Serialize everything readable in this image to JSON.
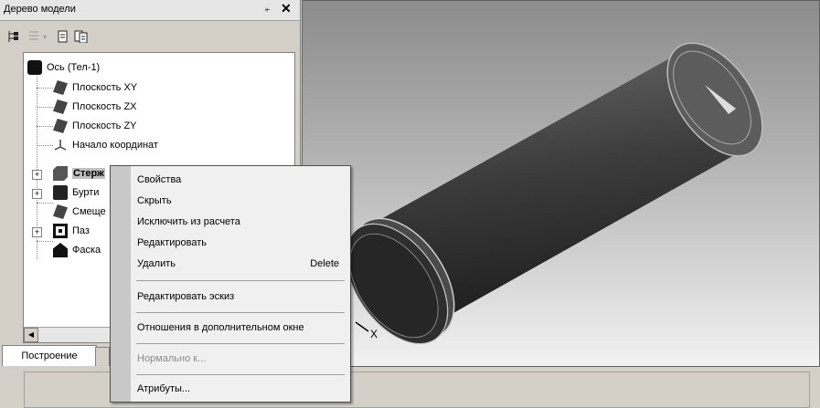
{
  "panel": {
    "title": "Дерево модели",
    "pin": "⍅",
    "close": "✕",
    "toolbar": [
      "tree-view-icon",
      "list-view-icon",
      "dropdown-arrow-icon",
      "page-icon",
      "pages-icon"
    ]
  },
  "tree": {
    "root": "Ось (Тел-1)",
    "items": [
      {
        "label": "Плоскость XY",
        "icon": "plane-icon"
      },
      {
        "label": "Плоскость ZX",
        "icon": "plane-icon"
      },
      {
        "label": "Плоскость ZY",
        "icon": "plane-icon"
      },
      {
        "label": "Начало координат",
        "icon": "origin-icon"
      },
      {
        "label": "Стерж",
        "icon": "extrude-icon",
        "expand": "+",
        "bold": true
      },
      {
        "label": "Бурти",
        "icon": "collar-icon",
        "expand": "+"
      },
      {
        "label": "Смеще",
        "icon": "plane-icon"
      },
      {
        "label": "Паз",
        "icon": "groove-icon",
        "expand": "+"
      },
      {
        "label": "Фаска",
        "icon": "chamfer-icon"
      }
    ]
  },
  "tabs": {
    "build": "Построение"
  },
  "viewport": {
    "axis_label": "X"
  },
  "context_menu": {
    "items": [
      {
        "label": "Свойства"
      },
      {
        "label": "Скрыть"
      },
      {
        "label": "Исключить из расчета"
      },
      {
        "label": "Редактировать"
      },
      {
        "label": "Удалить",
        "shortcut": "Delete"
      },
      {
        "label": "Редактировать эскиз"
      },
      {
        "label": "Отношения в дополнительном окне"
      },
      {
        "label": "Нормально к...",
        "disabled": true
      },
      {
        "label": "Атрибуты..."
      }
    ]
  }
}
